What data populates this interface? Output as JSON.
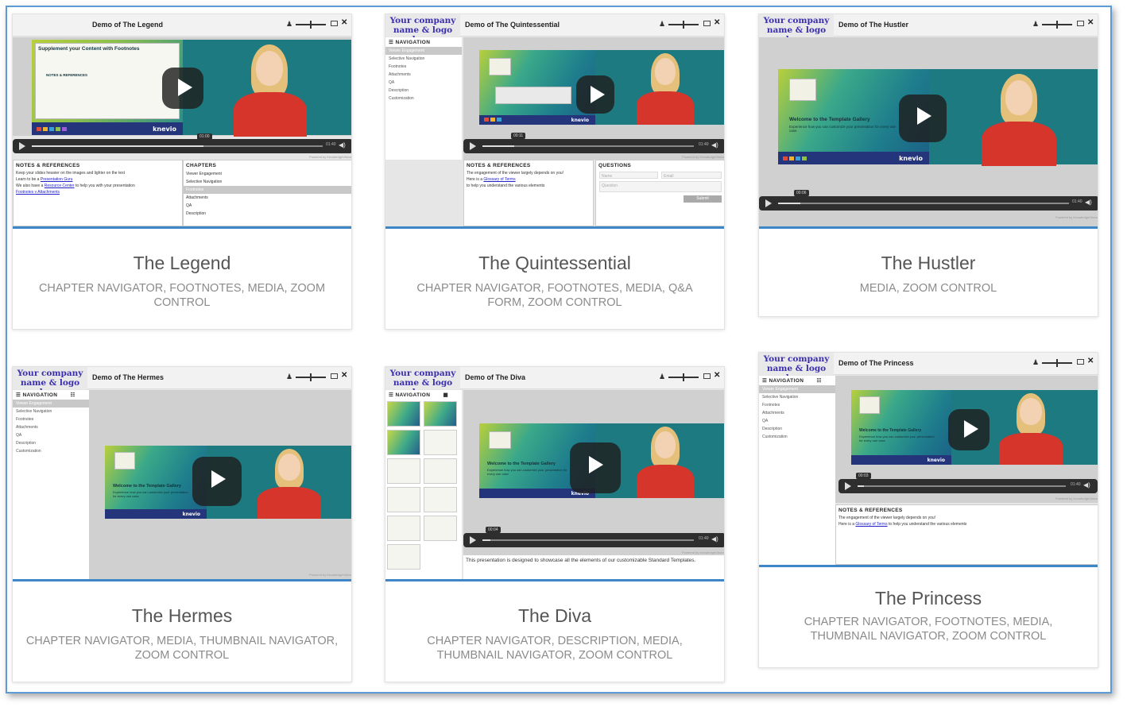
{
  "cards": [
    {
      "title": "The Legend",
      "features": "CHAPTER NAVIGATOR, FOOTNOTES, MEDIA, ZOOM CONTROL",
      "demo_title": "Demo of The Legend",
      "slide_title": "Supplement your Content with Footnotes",
      "slide_box_title": "NOTES & REFERENCES",
      "timecode": "01:00",
      "duration": "01:40",
      "notes_header": "NOTES & REFERENCES",
      "notes": [
        "Keep your slides heavier on the images and lighter on the text",
        "Learn to be a",
        "Presentation Guru",
        "We also have a",
        "Resource Center",
        "to help you with your presentation",
        "Footnotes v Attachments"
      ],
      "chapters_header": "CHAPTERS",
      "chapters": [
        "Viewer Engagement",
        "Selective Navigation",
        "Footnotes",
        "Attachments",
        "QA",
        "Description"
      ],
      "selected_chapter": "Footnotes",
      "powered": "Powered by KnowledgeVision"
    },
    {
      "title": "The Quintessential",
      "features": "CHAPTER NAVIGATOR, FOOTNOTES, MEDIA, Q&A FORM, ZOOM CONTROL",
      "demo_title": "Demo of The Quintessential",
      "logo": "Your company name & logo here",
      "nav_header": "NAVIGATION",
      "nav_items": [
        "Viewer Engagement",
        "Selective Navigation",
        "Footnotes",
        "Attachments",
        "QA",
        "Description",
        "Customization"
      ],
      "timecode": "00:11",
      "duration": "01:40",
      "notes_header": "NOTES & REFERENCES",
      "notes": [
        "The engagement of the viewer largely depends on you!",
        "Here is a",
        "Glossary of Terms",
        "to help you understand the various elements"
      ],
      "questions_header": "QUESTIONS",
      "name_placeholder": "Name",
      "email_placeholder": "Email",
      "question_placeholder": "Question",
      "submit_label": "Submit",
      "powered": "Powered by KnowledgeVision"
    },
    {
      "title": "The Hustler",
      "features": "MEDIA, ZOOM CONTROL",
      "demo_title": "Demo of The Hustler",
      "logo": "Your company name & logo here",
      "slide_title": "Welcome to the Template Gallery",
      "slide_sub": "Experience how you can customize your presentation for every use case",
      "brand": "knevio",
      "timecode": "00:06",
      "duration": "01:40",
      "powered": "Powered by KnowledgeVision"
    },
    {
      "title": "The Hermes",
      "features": "CHAPTER NAVIGATOR, MEDIA, THUMBNAIL NAVIGATOR, ZOOM CONTROL",
      "demo_title": "Demo of The Hermes",
      "logo": "Your company name & logo here",
      "nav_header": "NAVIGATION",
      "nav_items": [
        "Viewer Engagement",
        "Selective Navigation",
        "Footnotes",
        "Attachments",
        "QA",
        "Description",
        "Customization"
      ],
      "slide_title": "Welcome to the Template Gallery",
      "slide_sub": "Experience how you can customize your presentation for every use case",
      "brand": "knevio",
      "powered": "Powered by KnowledgeVision"
    },
    {
      "title": "The Diva",
      "features": "CHAPTER NAVIGATOR, DESCRIPTION, MEDIA, THUMBNAIL NAVIGATOR, ZOOM CONTROL",
      "demo_title": "Demo of The Diva",
      "logo": "Your company name & logo here",
      "nav_header": "NAVIGATION",
      "slide_title": "Welcome to the Template Gallery",
      "slide_sub": "Experience how you can customize your presentation for every use case",
      "brand": "knevio",
      "timecode": "00:04",
      "duration": "01:40",
      "description": "This presentation is designed to showcase all the elements of our customizable Standard Templates.",
      "powered": "Powered by KnowledgeVision"
    },
    {
      "title": "The Princess",
      "features": "CHAPTER NAVIGATOR, FOOTNOTES, MEDIA, THUMBNAIL NAVIGATOR, ZOOM CONTROL",
      "demo_title": "Demo of The Princess",
      "logo": "Your company name & logo here",
      "nav_header": "NAVIGATION",
      "nav_items": [
        "Viewer Engagement",
        "Selective Navigation",
        "Footnotes",
        "Attachments",
        "QA",
        "Description",
        "Customization"
      ],
      "slide_title": "Welcome to the Template Gallery",
      "slide_sub": "Experience how you can customize your presentation for every use case",
      "brand": "knevio",
      "timecode": "00:03",
      "duration": "01:40",
      "notes_header": "NOTES & REFERENCES",
      "notes": [
        "The engagement of the viewer largely depends on you!",
        "Here is a",
        "Glossary of Terms",
        "to help you understand the various elements"
      ],
      "powered": "Powered by KnowledgeVision"
    }
  ],
  "colors": {
    "accent": "#3d86c8",
    "border": "#5b9bd8",
    "logo": "#3a2eb0",
    "presenter_red": "#d6352c"
  }
}
